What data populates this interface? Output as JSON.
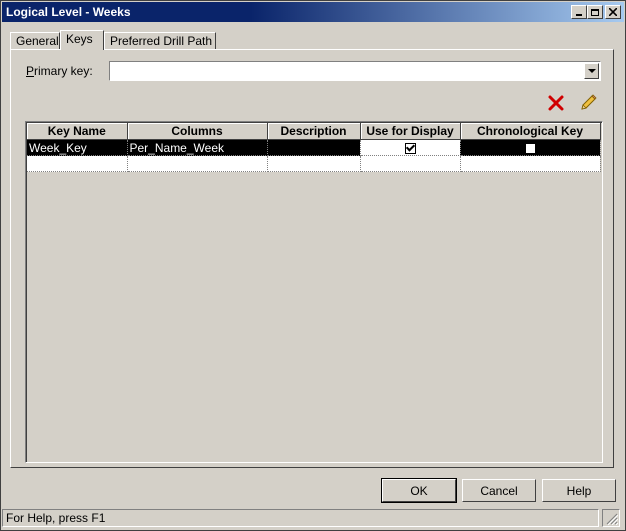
{
  "window": {
    "title": "Logical Level - Weeks"
  },
  "tabs": [
    {
      "label": "General"
    },
    {
      "label": "Keys"
    },
    {
      "label": "Preferred Drill Path"
    }
  ],
  "active_tab": "Keys",
  "primary_key": {
    "label_accel": "P",
    "label_rest": "rimary key:",
    "value": ""
  },
  "toolbar": {
    "delete_icon": "red-x-delete-icon",
    "edit_icon": "pencil-edit-icon"
  },
  "grid": {
    "columns": [
      "Key Name",
      "Columns",
      "Description",
      "Use for Display",
      "Chronological Key"
    ],
    "rows": [
      {
        "key_name": "Week_Key",
        "columns": "Per_Name_Week",
        "description": "",
        "use_for_display": true,
        "chronological_key": false
      }
    ]
  },
  "buttons": {
    "ok": "OK",
    "cancel": "Cancel",
    "help": "Help"
  },
  "status": {
    "text": "For Help, press F1"
  },
  "colors": {
    "title_active": "#0a246a",
    "face": "#d4d0c8",
    "selection": "#000000",
    "delete_red": "#d00000"
  }
}
